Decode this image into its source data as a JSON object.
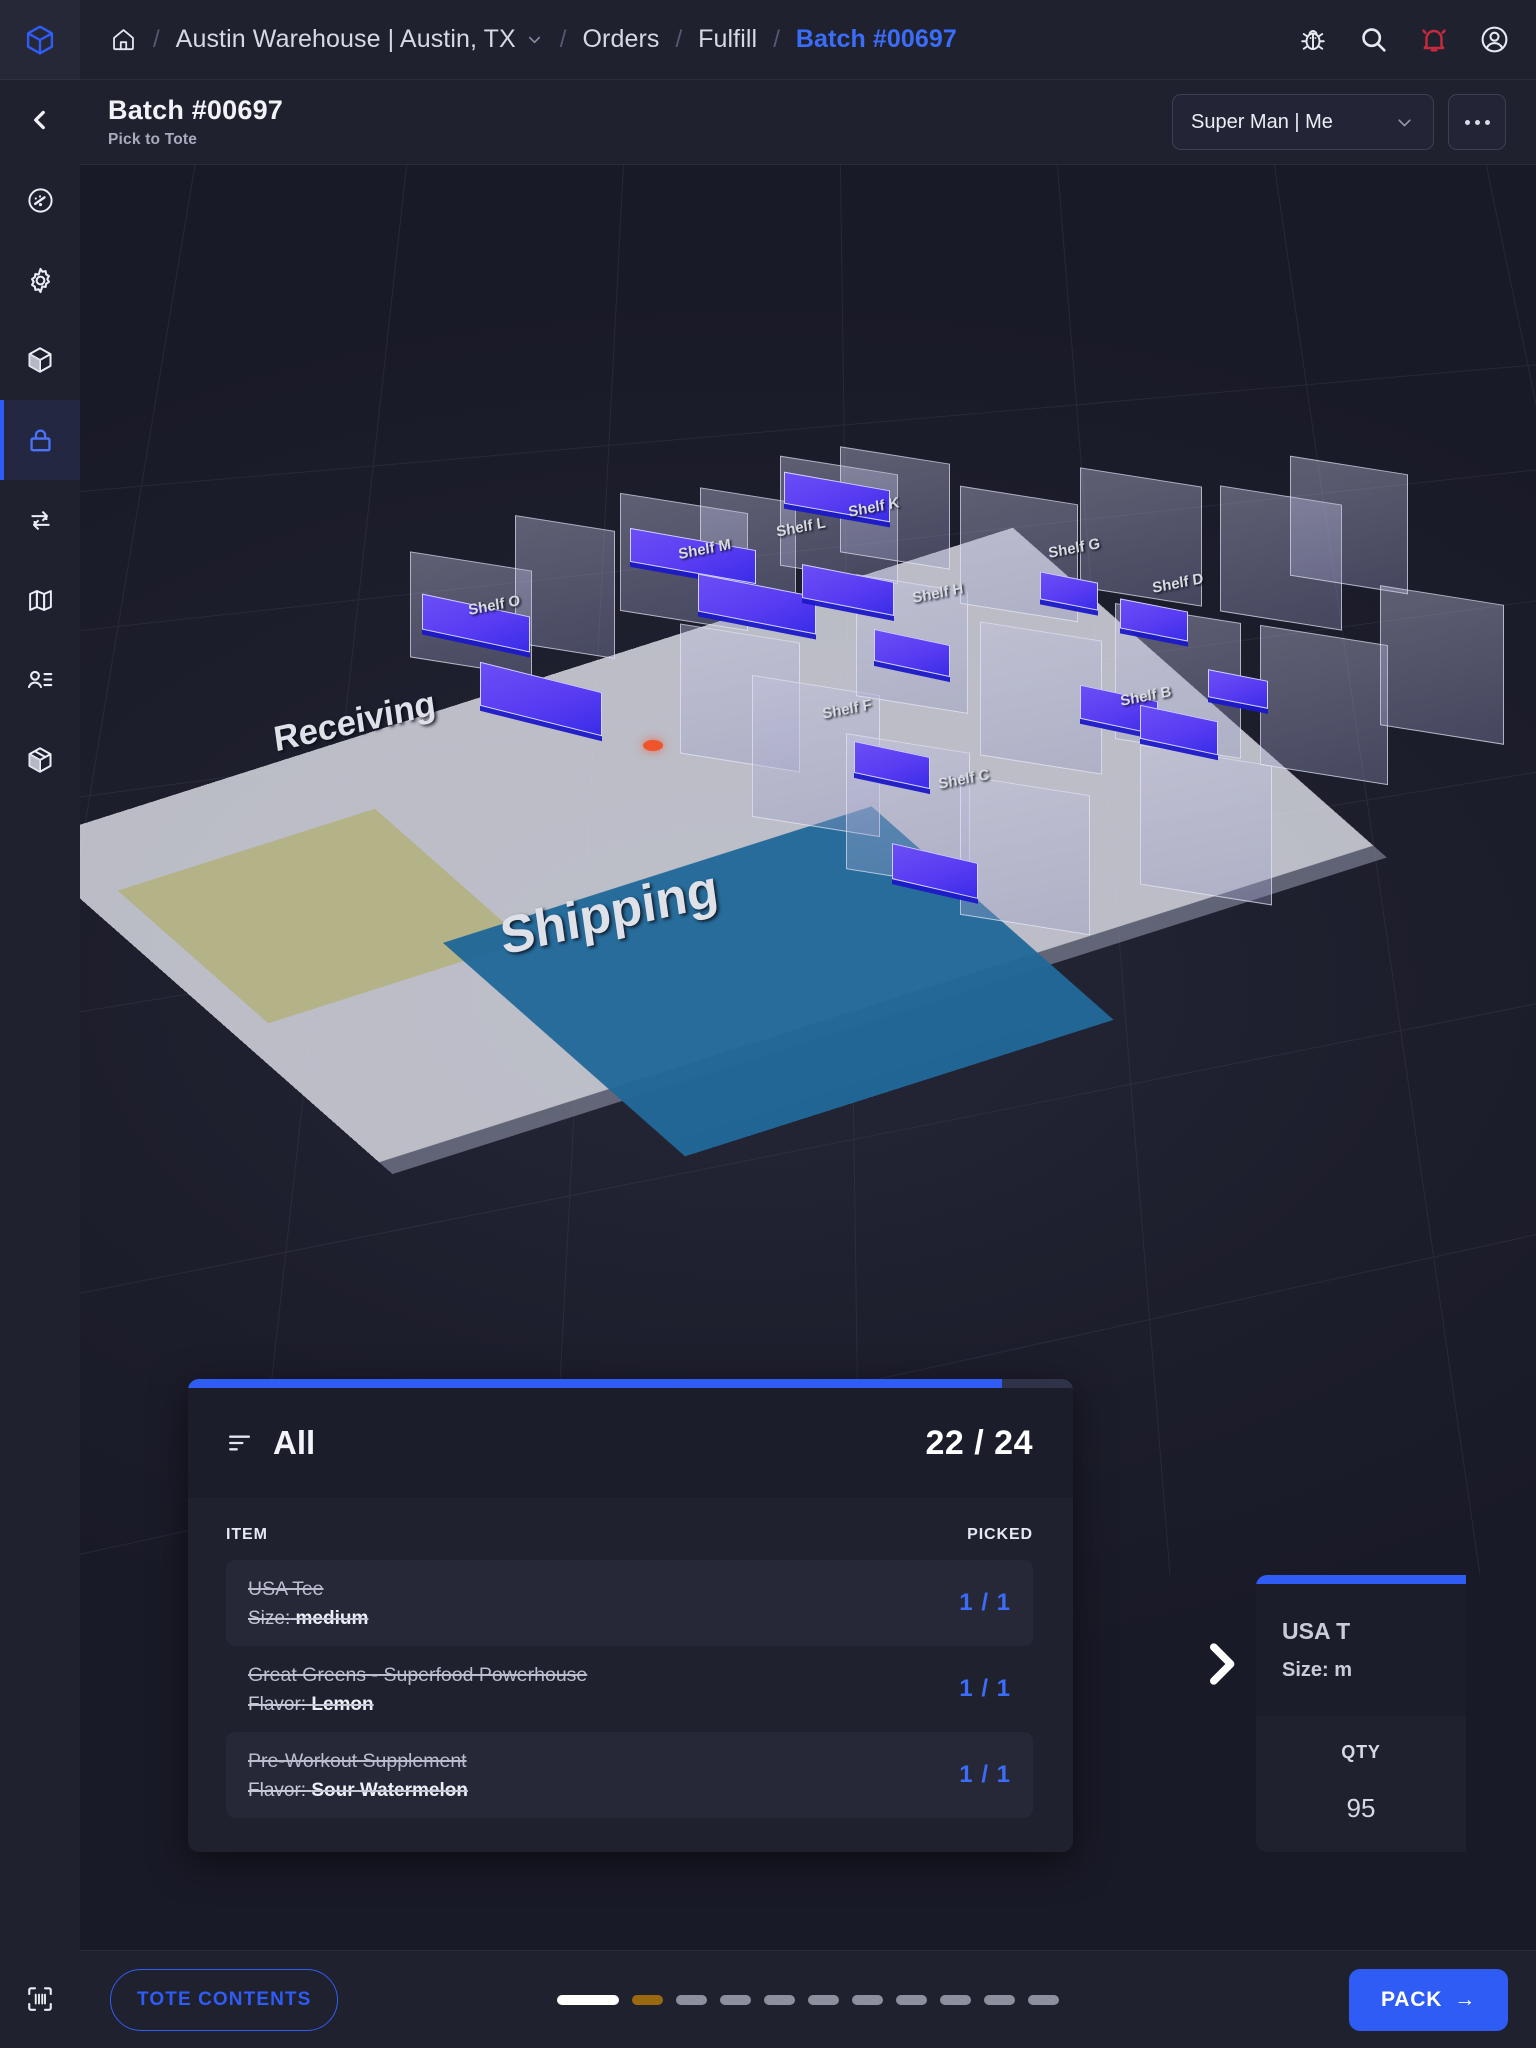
{
  "app": {
    "logo_icon": "cube-logo-icon",
    "accent_color": "#2f5cf5",
    "bg_color": "#1b1c2a"
  },
  "sidebar": {
    "collapse_icon": "chevron-left-icon",
    "items": [
      {
        "name": "dashboard",
        "icon": "gauge-icon",
        "active": false
      },
      {
        "name": "settings",
        "icon": "gear-icon",
        "active": false
      },
      {
        "name": "inventory",
        "icon": "cube-icon",
        "active": false
      },
      {
        "name": "fulfill",
        "icon": "lock-icon",
        "active": true
      },
      {
        "name": "transfers",
        "icon": "sync-arrows-icon",
        "active": false
      },
      {
        "name": "map",
        "icon": "map-icon",
        "active": false
      },
      {
        "name": "users",
        "icon": "user-list-icon",
        "active": false
      },
      {
        "name": "packages",
        "icon": "package-box-icon",
        "active": false
      }
    ],
    "scan_icon": "barcode-scan-icon"
  },
  "topbar": {
    "home_icon": "home-icon",
    "breadcrumbs": [
      {
        "label": "Austin Warehouse | Austin, TX",
        "has_chevron": true,
        "current": false
      },
      {
        "label": "Orders",
        "has_chevron": false,
        "current": false
      },
      {
        "label": "Fulfill",
        "has_chevron": false,
        "current": false
      },
      {
        "label": "Batch #00697",
        "has_chevron": false,
        "current": true
      }
    ],
    "separator": "/",
    "icons": [
      {
        "name": "bug-icon",
        "color": "#e8eaf2"
      },
      {
        "name": "search-icon",
        "color": "#e8eaf2"
      },
      {
        "name": "notification-bell-icon",
        "color": "#c32a3e"
      },
      {
        "name": "account-icon",
        "color": "#e8eaf2"
      }
    ]
  },
  "page_header": {
    "title": "Batch #00697",
    "subtitle": "Pick to Tote",
    "assignee_select": {
      "value": "Super Man | Me",
      "chevron_icon": "chevron-down-icon"
    },
    "overflow_label": "•••"
  },
  "scene": {
    "zones": [
      {
        "label": "Receiving",
        "color": "#b2b083"
      },
      {
        "label": "Shipping",
        "color": "#206898"
      }
    ],
    "shelf_labels": [
      "Shelf O",
      "Shelf M",
      "Shelf L",
      "Shelf K",
      "Shelf H",
      "Shelf G",
      "Shelf D",
      "Shelf F",
      "Shelf C",
      "Shelf B"
    ],
    "picker_marker_color": "#f0542d",
    "bin_highlight_color": "#5a3df2"
  },
  "pick_card": {
    "progress_percent": 92,
    "filter_icon": "filter-sort-icon",
    "filter_label": "All",
    "count": "22 / 24",
    "columns": {
      "item": "ITEM",
      "picked": "PICKED"
    },
    "rows": [
      {
        "name": "USA Tee",
        "meta_key": "Size:",
        "meta_val": "medium",
        "picked": "1 / 1",
        "struck": true
      },
      {
        "name": "Great Greens - Superfood Powerhouse",
        "meta_key": "Flavor:",
        "meta_val": "Lemon",
        "picked": "1 / 1",
        "struck": true
      },
      {
        "name": "Pre-Workout Supplement",
        "meta_key": "Flavor:",
        "meta_val": "Sour Watermelon",
        "picked": "1 / 1",
        "struck": true
      }
    ]
  },
  "peek_card": {
    "title": "USA T",
    "meta": "Size: m",
    "qty_label": "QTY",
    "qty_value": "95",
    "next_icon": "chevron-right-icon"
  },
  "bottom_bar": {
    "tote_button": "TOTE CONTENTS",
    "pack_button": "PACK",
    "pack_arrow": "→",
    "pagination": [
      {
        "state": "active"
      },
      {
        "state": "warn"
      },
      {
        "state": "idle"
      },
      {
        "state": "idle"
      },
      {
        "state": "idle"
      },
      {
        "state": "idle"
      },
      {
        "state": "idle"
      },
      {
        "state": "idle"
      },
      {
        "state": "idle"
      },
      {
        "state": "idle"
      },
      {
        "state": "idle"
      }
    ]
  }
}
